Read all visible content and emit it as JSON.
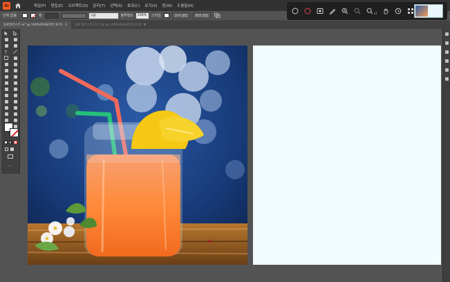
{
  "menu": {
    "items": [
      "파일(F)",
      "편집(E)",
      "오브젝트(O)",
      "문자(T)",
      "선택(S)",
      "효과(C)",
      "보기(V)",
      "창(W)",
      "도움말(H)"
    ]
  },
  "controlbar": {
    "selection_label": "선택 없음",
    "stroke_label": "획",
    "style_label": "기본",
    "opacity_label": "불투명도",
    "opacity_value": "100%",
    "style2_label": "스타일",
    "doc_setup_button": "문서 설정",
    "preferences_button": "환경 설정"
  },
  "tabs": [
    {
      "label": "동료일러스트.ai* @ 100%(RGB/미리 보기)",
      "active": true
    },
    {
      "label": "동료 일러스트(그)-1.ai @ 100%(RGB/미리 보기)",
      "active": false
    }
  ],
  "overlay": {
    "subscript": "x1"
  },
  "colors": {
    "menubar_bg": "#323232",
    "workspace_bg": "#535353",
    "artboard_bg": "#f0fcfd",
    "logo_accent": "#ff5c1f"
  },
  "image": {
    "subject": "orange lemonade in mason jar with straws and lemon slice"
  }
}
